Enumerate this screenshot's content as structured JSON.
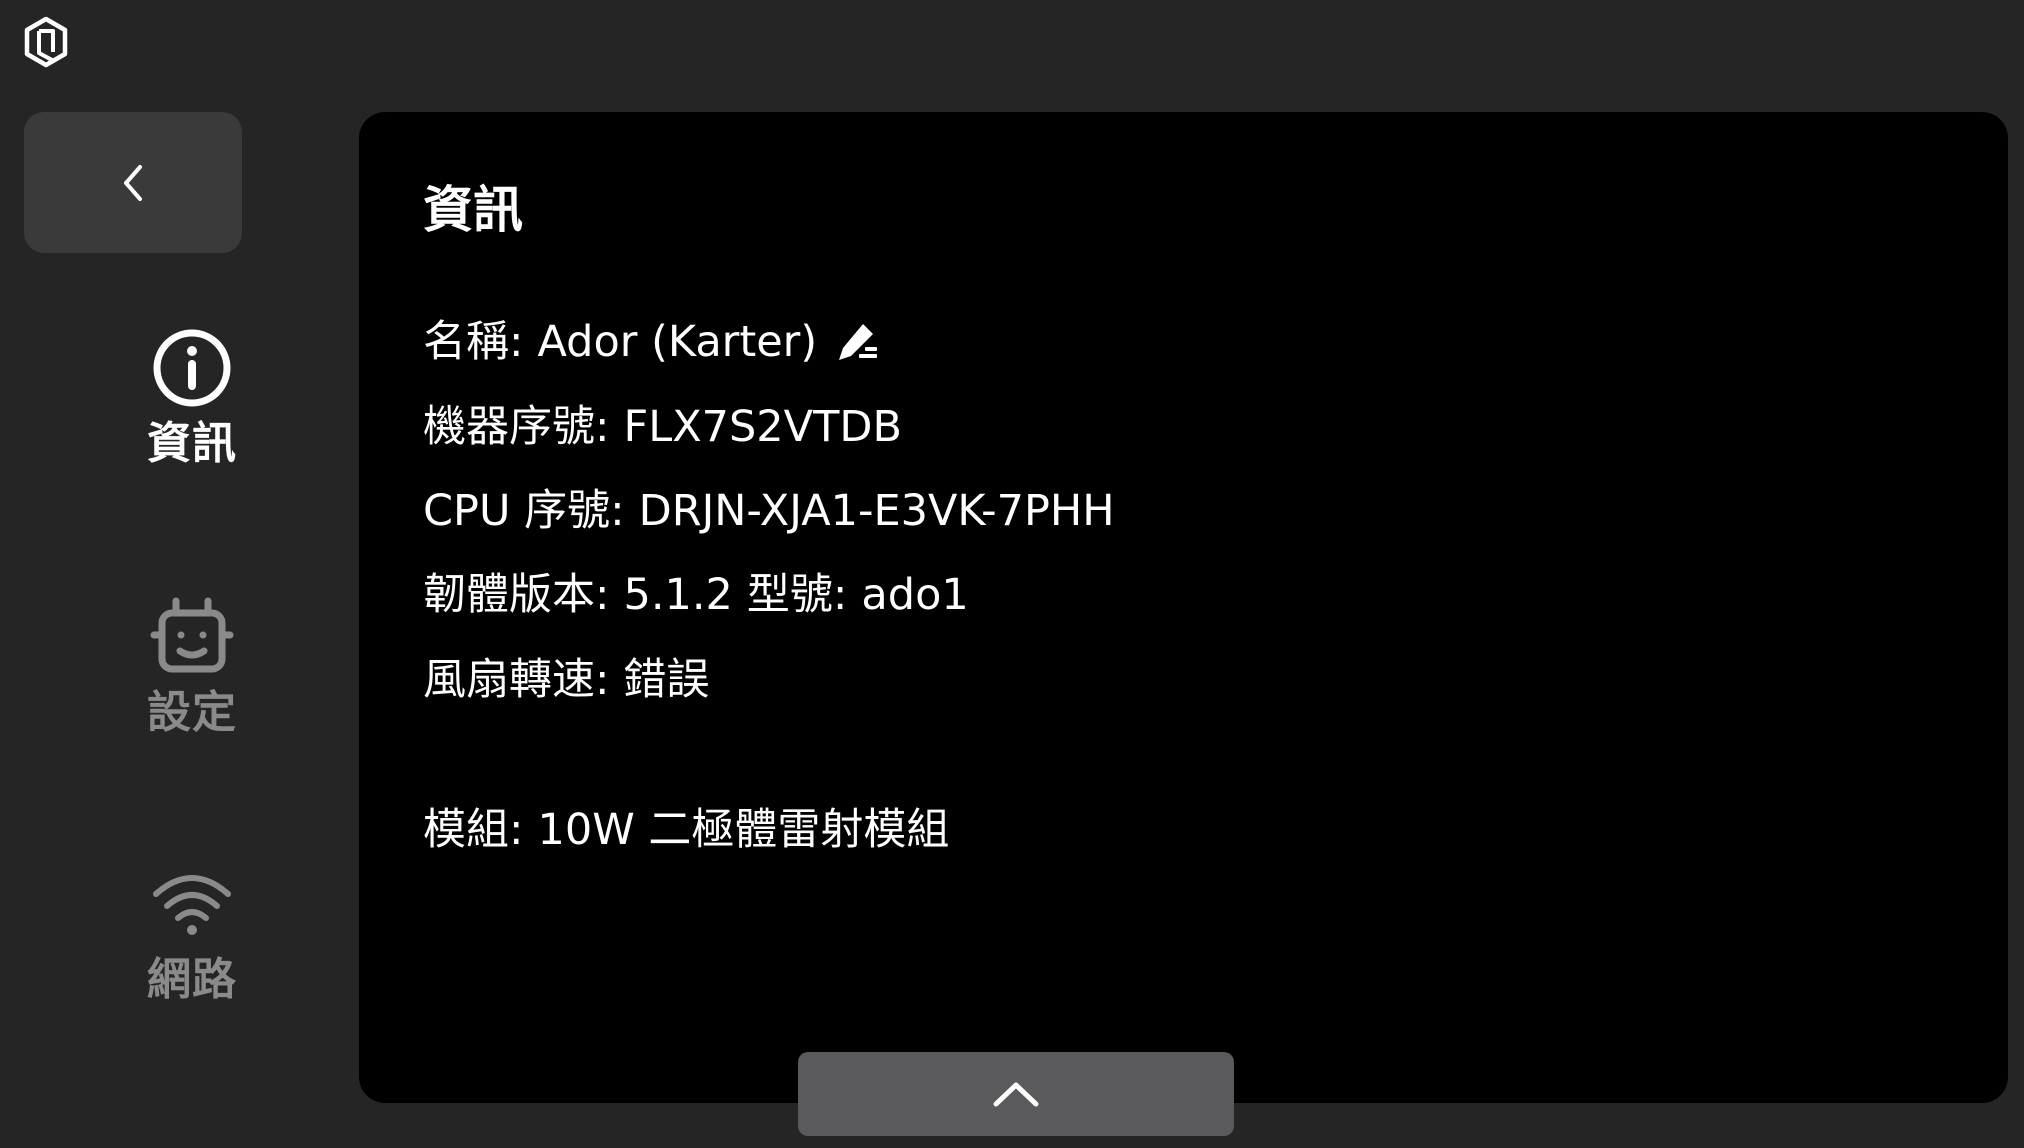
{
  "icons": {
    "logo": "logo-icon",
    "back": "chevron-left-icon",
    "info": "info-circle-icon",
    "settings": "robot-settings-icon",
    "network": "wifi-icon",
    "edit": "pencil-edit-icon",
    "scroll_up": "chevron-up-icon"
  },
  "colors": {
    "background": "#252525",
    "panel": "#000000",
    "back_button": "#3a3a3a",
    "scroll_button": "#5a5a5c",
    "active_text": "#ffffff",
    "inactive_text": "#8a8a8a"
  },
  "sidebar": {
    "items": [
      {
        "id": "info",
        "label": "資訊",
        "active": true
      },
      {
        "id": "settings",
        "label": "設定",
        "active": false
      },
      {
        "id": "network",
        "label": "網路",
        "active": false
      }
    ]
  },
  "panel": {
    "title": "資訊",
    "name": {
      "label": "名稱:",
      "value": "Ador (Karter)"
    },
    "serial": {
      "label": "機器序號:",
      "value": "FLX7S2VTDB"
    },
    "cpu": {
      "label": "CPU 序號:",
      "value": "DRJN-XJA1-E3VK-7PHH"
    },
    "firmware": {
      "label": "韌體版本:",
      "value": "5.1.2",
      "model_label": "型號:",
      "model_value": "ado1"
    },
    "fan": {
      "label": "風扇轉速:",
      "value": "錯誤"
    },
    "module": {
      "label": "模組:",
      "value": "10W 二極體雷射模組"
    }
  }
}
